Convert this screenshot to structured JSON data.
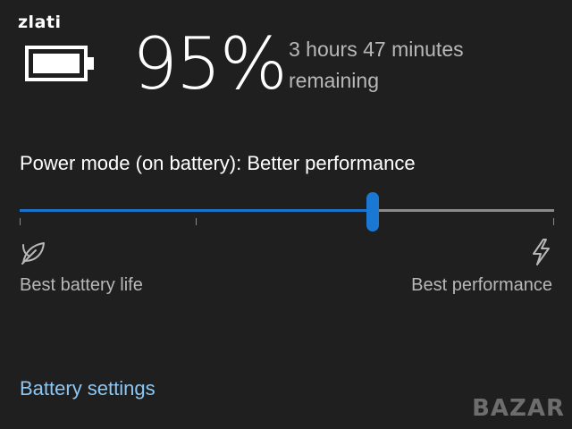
{
  "watermark": {
    "user": "zlati",
    "brand": "BAZAR"
  },
  "battery": {
    "icon": "battery-full-icon",
    "percent_label": "95%",
    "percent_value": 95,
    "remaining_text": "3 hours 47 minutes remaining"
  },
  "power_mode": {
    "label": "Power mode (on battery): Better performance",
    "slider": {
      "value_fraction": 0.66,
      "tick_fractions": [
        0,
        0.33,
        1
      ],
      "track_color": "#8a8a8a",
      "fill_color": "#1a73c8",
      "thumb_color": "#1a78d4"
    },
    "left_icon": "leaf-icon",
    "left_label": "Best battery life",
    "right_icon": "lightning-bolt-icon",
    "right_label": "Best performance"
  },
  "links": {
    "battery_settings": "Battery settings",
    "link_color": "#8cc8f5"
  },
  "colors": {
    "background": "#1f1f1f",
    "primary_text": "#ffffff",
    "secondary_text": "#b8b8b8"
  }
}
